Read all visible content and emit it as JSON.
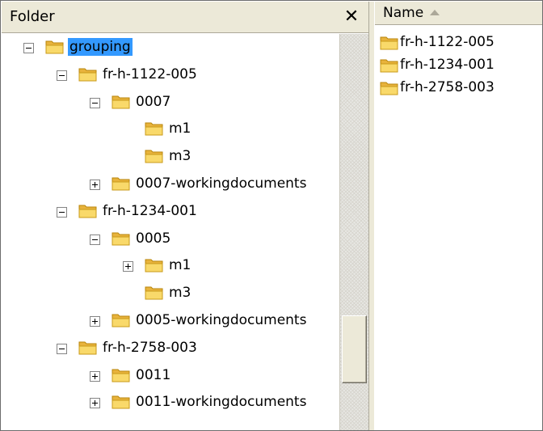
{
  "folder_pane": {
    "title": "Folder",
    "close_glyph": "✕",
    "tree": [
      {
        "label": "grouping",
        "toggle": "minus",
        "selected": true
      },
      {
        "label": "fr-h-1122-005",
        "toggle": "minus"
      },
      {
        "label": "0007",
        "toggle": "minus"
      },
      {
        "label": "m1",
        "toggle": "none"
      },
      {
        "label": "m3",
        "toggle": "none"
      },
      {
        "label": "0007-workingdocuments",
        "toggle": "plus"
      },
      {
        "label": "fr-h-1234-001",
        "toggle": "minus"
      },
      {
        "label": "0005",
        "toggle": "minus"
      },
      {
        "label": "m1",
        "toggle": "plus"
      },
      {
        "label": "m3",
        "toggle": "none"
      },
      {
        "label": "0005-workingdocuments",
        "toggle": "plus"
      },
      {
        "label": "fr-h-2758-003",
        "toggle": "minus"
      },
      {
        "label": "0011",
        "toggle": "plus"
      },
      {
        "label": "0011-workingdocuments",
        "toggle": "plus"
      }
    ]
  },
  "list_pane": {
    "column_name": "Name",
    "items": [
      "fr-h-1122-005",
      "fr-h-1234-001",
      "fr-h-2758-003"
    ]
  },
  "colors": {
    "selection": "#3399ff",
    "chrome": "#ece9d8",
    "folder": "#f5c842"
  }
}
